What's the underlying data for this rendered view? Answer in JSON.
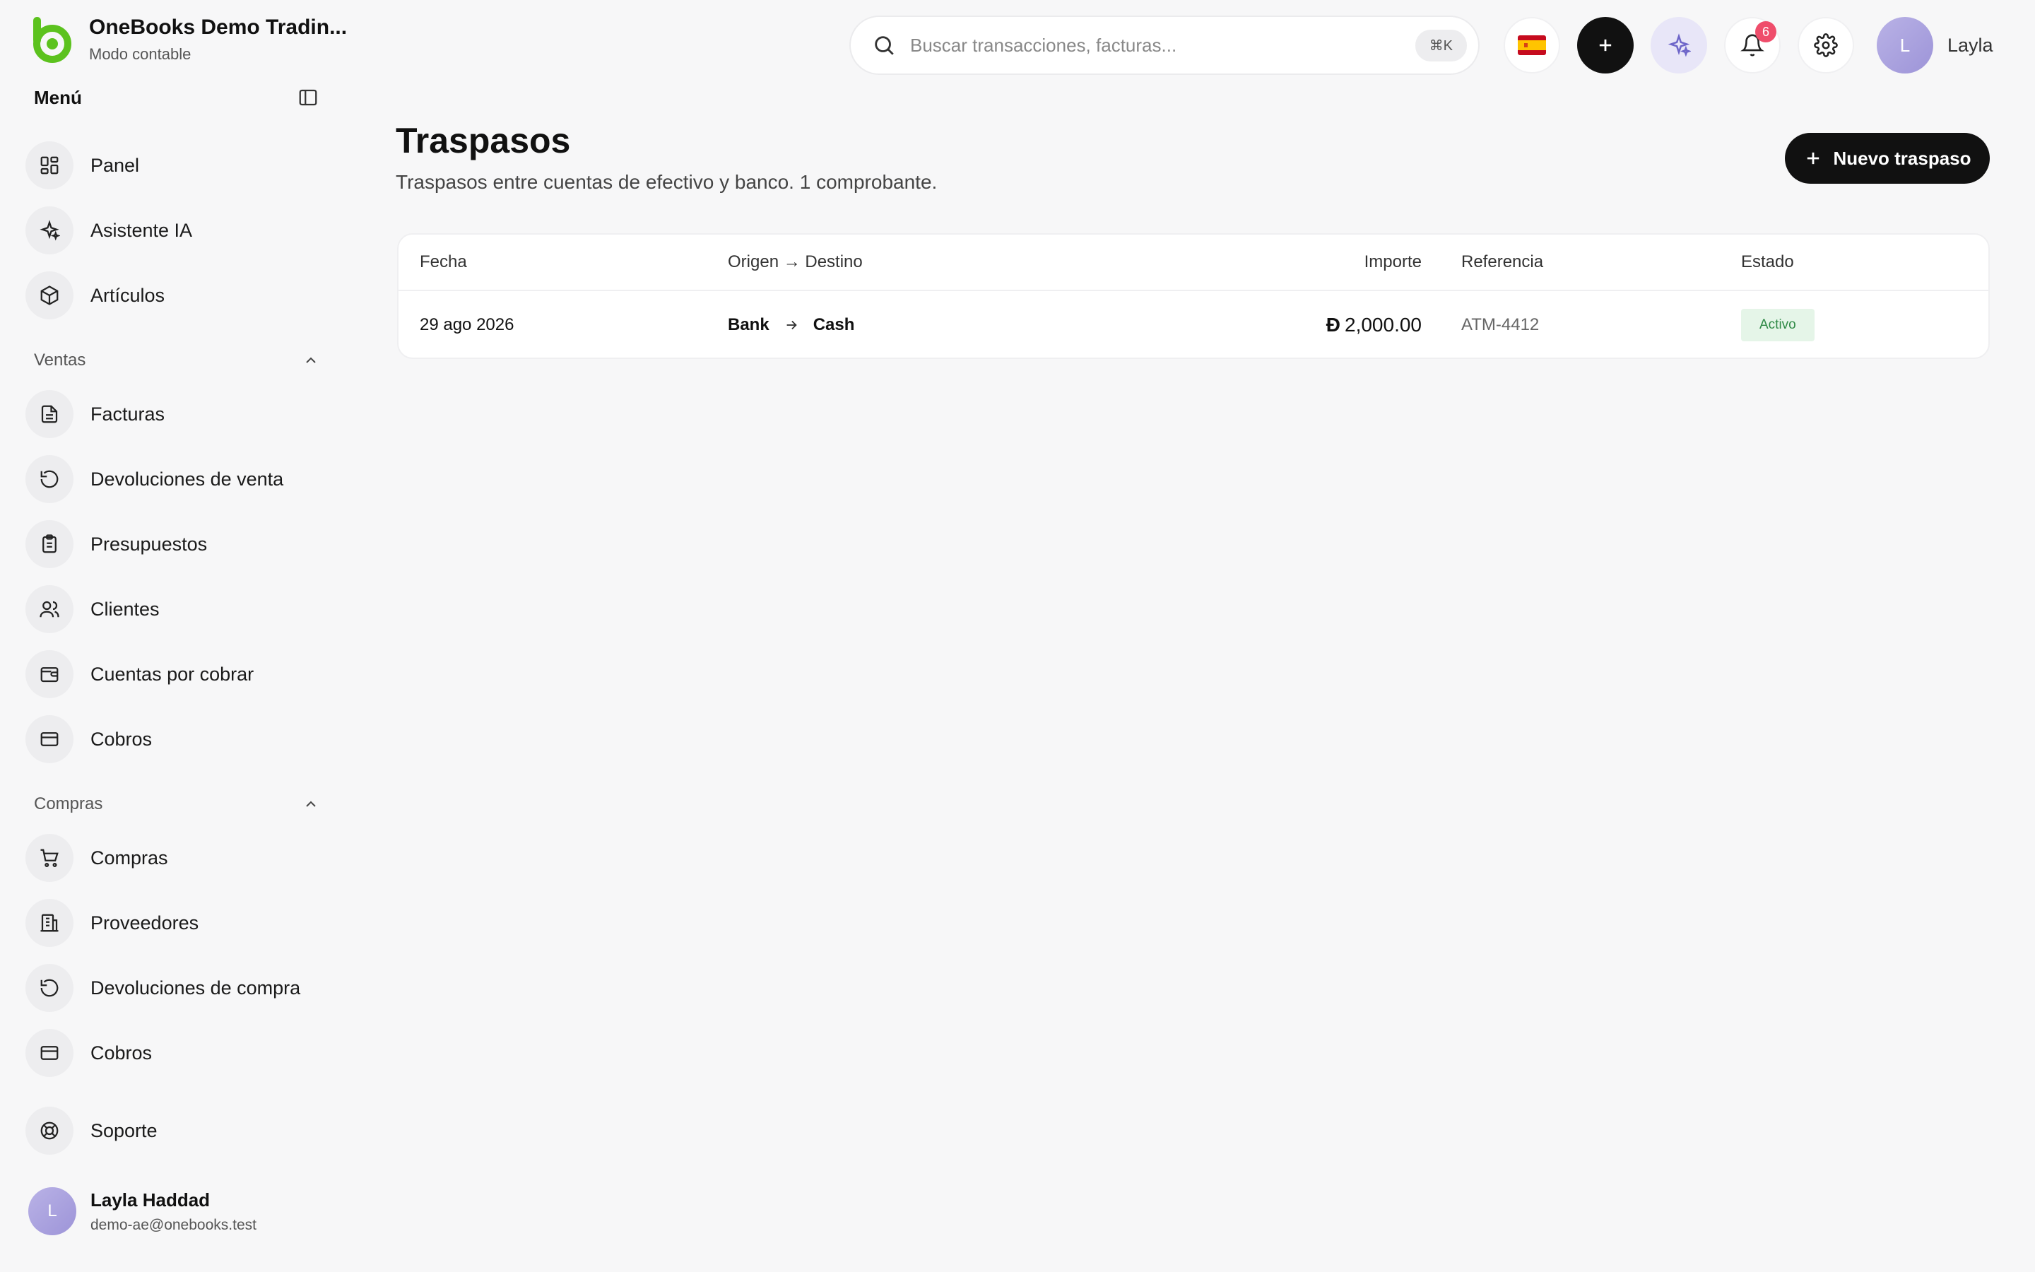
{
  "brand": {
    "name": "OneBooks Demo Tradin...",
    "mode": "Modo contable"
  },
  "menu": {
    "title": "Menú"
  },
  "nav_main": [
    {
      "label": "Panel"
    },
    {
      "label": "Asistente IA"
    },
    {
      "label": "Artículos"
    }
  ],
  "sales": {
    "section": "Ventas",
    "items": [
      {
        "label": "Facturas"
      },
      {
        "label": "Devoluciones de venta"
      },
      {
        "label": "Presupuestos"
      },
      {
        "label": "Clientes"
      },
      {
        "label": "Cuentas por cobrar"
      },
      {
        "label": "Cobros"
      }
    ]
  },
  "purchases": {
    "section": "Compras",
    "items": [
      {
        "label": "Compras"
      },
      {
        "label": "Proveedores"
      },
      {
        "label": "Devoluciones de compra"
      },
      {
        "label": "Cobros"
      }
    ]
  },
  "support": {
    "label": "Soporte"
  },
  "user": {
    "initial": "L",
    "name": "Layla Haddad",
    "email": "demo-ae@onebooks.test",
    "short_name": "Layla"
  },
  "search": {
    "placeholder": "Buscar transacciones, facturas...",
    "shortcut": "⌘K"
  },
  "notifications": {
    "count": "6"
  },
  "page": {
    "title": "Traspasos",
    "subtitle": "Traspasos entre cuentas de efectivo y banco. 1 comprobante.",
    "new_button": "Nuevo traspaso"
  },
  "table": {
    "headers": {
      "fecha": "Fecha",
      "origen_destino": "Origen → Destino",
      "importe": "Importe",
      "referencia": "Referencia",
      "estado": "Estado"
    },
    "rows": [
      {
        "fecha": "29 ago 2026",
        "origen": "Bank",
        "destino": "Cash",
        "currency_symbol": "Đ",
        "importe": "2,000.00",
        "referencia": "ATM-4412",
        "estado": "Activo"
      }
    ]
  },
  "colors": {
    "brand_green": "#5cc21e",
    "primary_black": "#111111",
    "badge_red": "#ef4d6b",
    "status_green_bg": "#e5f5e8",
    "status_green_text": "#2f8a46",
    "avatar_purple": "#a59ddd"
  },
  "icons": {
    "panel": "dashboard-icon",
    "assistant": "sparkles-icon",
    "articles": "box-icon",
    "invoices": "document-icon",
    "sales_returns": "undo-icon",
    "quotes": "clipboard-icon",
    "customers": "users-icon",
    "receivables": "wallet-icon",
    "payments": "card-icon",
    "purchases": "cart-icon",
    "suppliers": "building-icon",
    "support": "lifebuoy-icon"
  }
}
